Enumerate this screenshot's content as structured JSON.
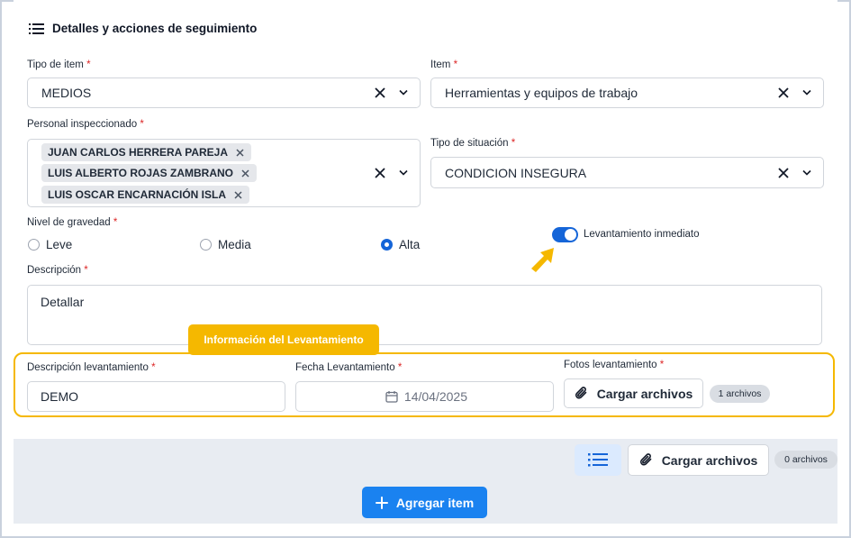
{
  "section": {
    "title": "Detalles y acciones de seguimiento",
    "icon": "list-icon"
  },
  "fields": {
    "tipo_item": {
      "label": "Tipo de item",
      "required_mark": "*",
      "value": "MEDIOS"
    },
    "item": {
      "label": "Item",
      "required_mark": "*",
      "value": "Herramientas y equipos de trabajo"
    },
    "personal": {
      "label": "Personal inspeccionado",
      "required_mark": "*",
      "chips": [
        "JUAN CARLOS HERRERA PAREJA",
        "LUIS ALBERTO ROJAS ZAMBRANO",
        "LUIS OSCAR ENCARNACIÓN ISLA"
      ]
    },
    "tipo_situacion": {
      "label": "Tipo de situación",
      "required_mark": "*",
      "value": "CONDICION INSEGURA"
    },
    "gravedad": {
      "label": "Nivel de gravedad",
      "required_mark": "*",
      "options": [
        "Leve",
        "Media",
        "Alta"
      ],
      "selected": "Alta"
    },
    "levantamiento_inmediato": {
      "label": "Levantamiento inmediato",
      "on": true
    },
    "descripcion": {
      "label": "Descripción",
      "required_mark": "*",
      "value": "Detallar"
    }
  },
  "levantamiento": {
    "callout": "Información del Levantamiento",
    "descripcion": {
      "label": "Descripción levantamiento",
      "required_mark": "*",
      "value": "DEMO"
    },
    "fecha": {
      "label": "Fecha Levantamiento",
      "required_mark": "*",
      "value": "14/04/2025"
    },
    "fotos": {
      "label": "Fotos levantamiento",
      "required_mark": "*",
      "button": "Cargar archivos",
      "count": "1 archivos"
    }
  },
  "footer": {
    "upload_button": "Cargar archivos",
    "count": "0 archivos",
    "add_button": "Agregar item"
  },
  "colors": {
    "accent": "#1565d8",
    "highlight": "#f5b800",
    "required": "#dc2626",
    "add_button": "#1a82f0"
  }
}
